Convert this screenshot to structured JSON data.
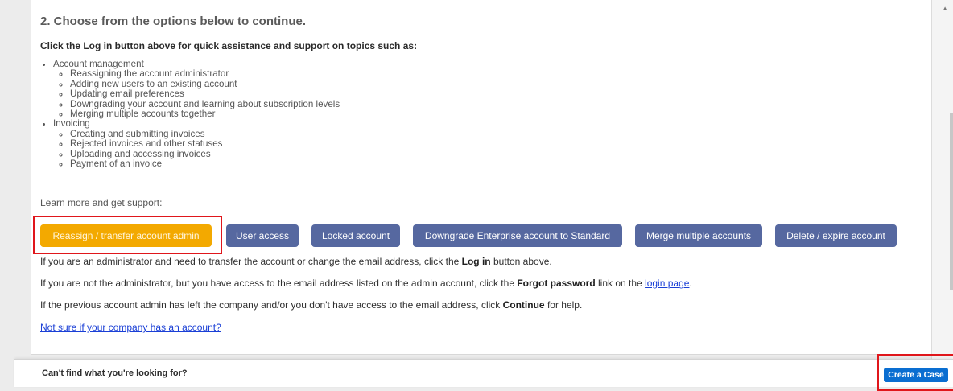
{
  "section": {
    "heading": "2. Choose from the options below to continue.",
    "intro": "Click the Log in button above for quick assistance and support on topics such as:"
  },
  "topics": [
    {
      "label": "Account management",
      "items": [
        "Reassigning the account administrator",
        "Adding new users to an existing account",
        "Updating email preferences",
        "Downgrading your account and learning about subscription levels",
        "Merging multiple accounts together"
      ]
    },
    {
      "label": "Invoicing",
      "items": [
        "Creating and submitting invoices",
        "Rejected invoices and other statuses",
        "Uploading and accessing invoices",
        "Payment of an invoice"
      ]
    }
  ],
  "support": {
    "label": "Learn more and get support:",
    "buttons": [
      "Reassign / transfer account admin",
      "User access",
      "Locked account",
      "Downgrade Enterprise account to Standard",
      "Merge multiple accounts",
      "Delete / expire account"
    ]
  },
  "paragraphs": {
    "p1_before": "If you are an administrator and need to transfer the account or change the email address, click the ",
    "p1_bold": "Log in",
    "p1_after": " button above.",
    "p2_before": "If you are not the administrator, but you have access to the email address listed on the admin account, click the ",
    "p2_bold": "Forgot password",
    "p2_mid": " link on the ",
    "p2_link": "login page",
    "p2_after": ".",
    "p3_before": "If the previous account admin has left the company and/or you don't have access to the email address, click ",
    "p3_bold": "Continue",
    "p3_after": " for help.",
    "not_sure_link": "Not sure if your company has an account?"
  },
  "footer": {
    "prompt": "Can't find what you're looking for?",
    "create_case": "Create a Case"
  },
  "colors": {
    "button_primary": "#5668a0",
    "button_highlight": "#f3a900",
    "create_case": "#0a6ed1",
    "annotation_box": "#e0161b",
    "link": "#1a3fd6"
  }
}
